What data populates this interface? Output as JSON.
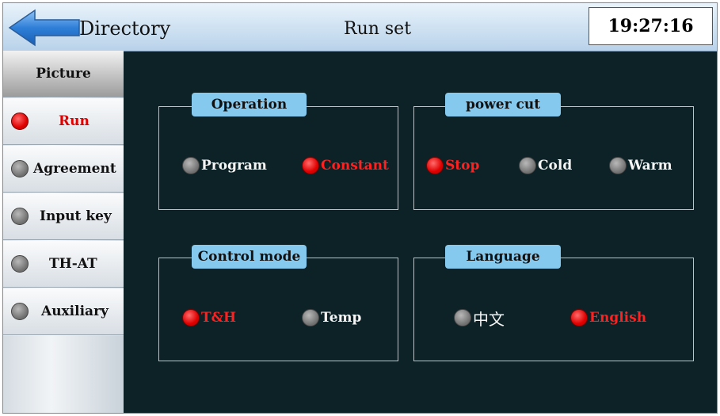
{
  "header": {
    "directory_label": "Directory",
    "title": "Run set",
    "clock": "19:27:16"
  },
  "sidebar": {
    "header_label": "Picture",
    "items": [
      {
        "label": "Run",
        "active": true
      },
      {
        "label": "Agreement",
        "active": false
      },
      {
        "label": "Input key",
        "active": false
      },
      {
        "label": "TH-AT",
        "active": false
      },
      {
        "label": "Auxiliary",
        "active": false
      }
    ]
  },
  "groups": {
    "operation": {
      "title": "Operation",
      "options": [
        {
          "label": "Program",
          "selected": false
        },
        {
          "label": "Constant",
          "selected": true
        }
      ]
    },
    "power_cut": {
      "title": "power cut",
      "options": [
        {
          "label": "Stop",
          "selected": true
        },
        {
          "label": "Cold",
          "selected": false
        },
        {
          "label": "Warm",
          "selected": false
        }
      ]
    },
    "control_mode": {
      "title": "Control mode",
      "options": [
        {
          "label": "T&H",
          "selected": true
        },
        {
          "label": "Temp",
          "selected": false
        }
      ]
    },
    "language": {
      "title": "Language",
      "options": [
        {
          "label": "中文",
          "selected": false
        },
        {
          "label": "English",
          "selected": true
        }
      ]
    }
  },
  "colors": {
    "background": "#0d2226",
    "accent_tab": "#86c9ef",
    "selected_text": "#ff2020",
    "selected_dot": "#e00000",
    "unselected_dot": "#8a8a8a"
  },
  "icons": {
    "back": "back-arrow-icon",
    "radio_on": "radio-red-icon",
    "radio_off": "radio-gray-icon"
  }
}
